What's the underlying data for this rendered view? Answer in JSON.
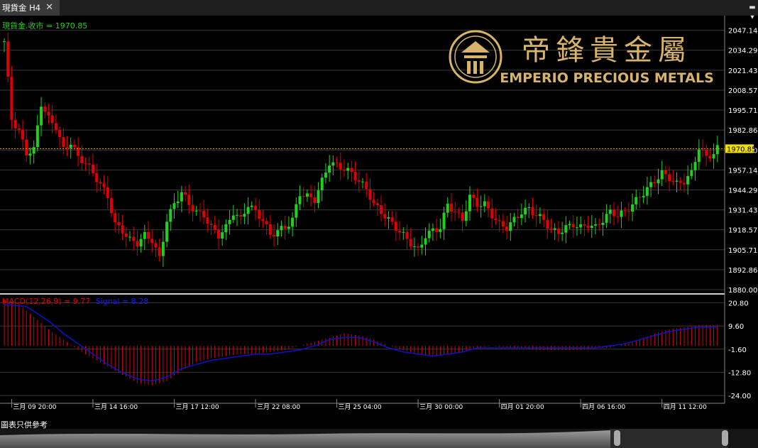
{
  "tab": {
    "title": "現貨金 H4",
    "close": "✕"
  },
  "logo": {
    "cn": "帝鋒貴金屬",
    "en": "EMPERIO PRECIOUS METALS"
  },
  "footer_note": "圖表只供參考",
  "colors": {
    "up": "#1fd11f",
    "down": "#e00000",
    "macd": "#e00000",
    "signal": "#1010cc",
    "grid": "#3a3a3a",
    "gold": "#d7b46a",
    "price_line": "#e8a000"
  },
  "chart_data": [
    {
      "type": "candlestick",
      "legend": "現貨金.收市 = 1970.85",
      "last_price": 1970.85,
      "price_tag": "1970.85",
      "ylim": [
        1880.0,
        2052.0
      ],
      "yticks": [
        "2047.14",
        "2034.29",
        "2021.43",
        "2008.57",
        "1995.71",
        "1982.86",
        "1970.00",
        "1957.14",
        "1944.29",
        "1931.43",
        "1918.57",
        "1905.71",
        "1892.86",
        "1880.00"
      ],
      "xticks": [
        "三月 09 20:00",
        "三月 14 16:00",
        "三月 17 12:00",
        "三月 22 08:00",
        "三月 25 04:00",
        "三月 30 00:00",
        "四月 01 20:00",
        "四月 06 16:00",
        "四月 11 12:00"
      ],
      "xtick_index": [
        2,
        24,
        46,
        68,
        90,
        112,
        134,
        156,
        178
      ],
      "bar_count": 194,
      "anchors": [
        [
          0,
          2040
        ],
        [
          2,
          1990
        ],
        [
          4,
          1982
        ],
        [
          6,
          1968
        ],
        [
          8,
          1970
        ],
        [
          10,
          2000
        ],
        [
          12,
          1990
        ],
        [
          14,
          1985
        ],
        [
          16,
          1970
        ],
        [
          18,
          1975
        ],
        [
          20,
          1965
        ],
        [
          22,
          1962
        ],
        [
          24,
          1955
        ],
        [
          26,
          1948
        ],
        [
          28,
          1940
        ],
        [
          30,
          1922
        ],
        [
          32,
          1918
        ],
        [
          34,
          1912
        ],
        [
          36,
          1910
        ],
        [
          38,
          1915
        ],
        [
          40,
          1912
        ],
        [
          42,
          1900
        ],
        [
          44,
          1925
        ],
        [
          46,
          1935
        ],
        [
          48,
          1943
        ],
        [
          50,
          1935
        ],
        [
          52,
          1930
        ],
        [
          54,
          1928
        ],
        [
          56,
          1920
        ],
        [
          58,
          1915
        ],
        [
          60,
          1920
        ],
        [
          62,
          1930
        ],
        [
          64,
          1925
        ],
        [
          66,
          1935
        ],
        [
          68,
          1930
        ],
        [
          70,
          1925
        ],
        [
          72,
          1915
        ],
        [
          74,
          1918
        ],
        [
          76,
          1920
        ],
        [
          78,
          1925
        ],
        [
          80,
          1942
        ],
        [
          82,
          1940
        ],
        [
          84,
          1938
        ],
        [
          86,
          1950
        ],
        [
          88,
          1962
        ],
        [
          90,
          1960
        ],
        [
          92,
          1958
        ],
        [
          94,
          1955
        ],
        [
          96,
          1950
        ],
        [
          98,
          1945
        ],
        [
          100,
          1935
        ],
        [
          102,
          1930
        ],
        [
          104,
          1925
        ],
        [
          106,
          1920
        ],
        [
          108,
          1915
        ],
        [
          110,
          1910
        ],
        [
          112,
          1905
        ],
        [
          114,
          1915
        ],
        [
          116,
          1918
        ],
        [
          118,
          1920
        ],
        [
          120,
          1935
        ],
        [
          122,
          1930
        ],
        [
          124,
          1925
        ],
        [
          126,
          1940
        ],
        [
          128,
          1935
        ],
        [
          130,
          1935
        ],
        [
          132,
          1928
        ],
        [
          134,
          1922
        ],
        [
          136,
          1920
        ],
        [
          138,
          1925
        ],
        [
          140,
          1930
        ],
        [
          142,
          1932
        ],
        [
          144,
          1928
        ],
        [
          146,
          1925
        ],
        [
          148,
          1918
        ],
        [
          150,
          1917
        ],
        [
          152,
          1920
        ],
        [
          154,
          1922
        ],
        [
          156,
          1920
        ],
        [
          158,
          1922
        ],
        [
          160,
          1920
        ],
        [
          162,
          1925
        ],
        [
          164,
          1930
        ],
        [
          166,
          1928
        ],
        [
          168,
          1930
        ],
        [
          170,
          1935
        ],
        [
          172,
          1940
        ],
        [
          174,
          1945
        ],
        [
          176,
          1950
        ],
        [
          178,
          1955
        ],
        [
          180,
          1952
        ],
        [
          182,
          1948
        ],
        [
          184,
          1950
        ],
        [
          186,
          1955
        ],
        [
          188,
          1972
        ],
        [
          190,
          1965
        ],
        [
          192,
          1968
        ],
        [
          193,
          1971
        ]
      ]
    },
    {
      "type": "macd",
      "legend_macd": "MACD(12,26,9) = 9.77",
      "legend_signal": "Signal = 8.28",
      "macd_value": 9.77,
      "signal_value": 8.28,
      "ylim": [
        -25.0,
        23.0
      ],
      "yticks": [
        "20.80",
        "9.60",
        "-1.60",
        "-12.80",
        "-24.00"
      ],
      "macd_anchors": [
        [
          0,
          22
        ],
        [
          4,
          20
        ],
        [
          8,
          14
        ],
        [
          12,
          8
        ],
        [
          16,
          3
        ],
        [
          20,
          -2
        ],
        [
          24,
          -6
        ],
        [
          28,
          -10
        ],
        [
          32,
          -14
        ],
        [
          36,
          -18
        ],
        [
          40,
          -19
        ],
        [
          44,
          -17
        ],
        [
          48,
          -12
        ],
        [
          52,
          -8
        ],
        [
          56,
          -6
        ],
        [
          60,
          -5
        ],
        [
          64,
          -4
        ],
        [
          68,
          -4
        ],
        [
          72,
          -3
        ],
        [
          76,
          -2
        ],
        [
          80,
          0
        ],
        [
          84,
          2
        ],
        [
          88,
          4
        ],
        [
          92,
          6
        ],
        [
          96,
          5
        ],
        [
          100,
          3
        ],
        [
          104,
          0
        ],
        [
          108,
          -2
        ],
        [
          112,
          -4
        ],
        [
          116,
          -5
        ],
        [
          120,
          -4
        ],
        [
          124,
          -3
        ],
        [
          128,
          -1
        ],
        [
          132,
          0
        ],
        [
          136,
          -1
        ],
        [
          140,
          -1
        ],
        [
          144,
          -2
        ],
        [
          148,
          -2
        ],
        [
          152,
          -2
        ],
        [
          156,
          -2
        ],
        [
          160,
          -1
        ],
        [
          164,
          -1
        ],
        [
          168,
          1
        ],
        [
          172,
          3
        ],
        [
          176,
          6
        ],
        [
          180,
          8
        ],
        [
          184,
          9
        ],
        [
          188,
          10
        ],
        [
          193,
          10
        ]
      ],
      "signal_anchors": [
        [
          0,
          20
        ],
        [
          6,
          19
        ],
        [
          12,
          12
        ],
        [
          16,
          6
        ],
        [
          20,
          1
        ],
        [
          24,
          -4
        ],
        [
          28,
          -9
        ],
        [
          32,
          -13
        ],
        [
          36,
          -16
        ],
        [
          40,
          -17
        ],
        [
          44,
          -15
        ],
        [
          48,
          -11
        ],
        [
          52,
          -9
        ],
        [
          56,
          -7
        ],
        [
          60,
          -6
        ],
        [
          64,
          -5
        ],
        [
          68,
          -4
        ],
        [
          72,
          -4
        ],
        [
          76,
          -3
        ],
        [
          80,
          -2
        ],
        [
          84,
          0
        ],
        [
          88,
          3
        ],
        [
          92,
          4
        ],
        [
          96,
          4
        ],
        [
          100,
          2
        ],
        [
          104,
          -1
        ],
        [
          108,
          -3
        ],
        [
          112,
          -4
        ],
        [
          116,
          -5
        ],
        [
          120,
          -4
        ],
        [
          124,
          -3
        ],
        [
          128,
          -1
        ],
        [
          132,
          -1
        ],
        [
          136,
          -1
        ],
        [
          140,
          -1
        ],
        [
          144,
          -1
        ],
        [
          148,
          -1
        ],
        [
          152,
          -1
        ],
        [
          156,
          -1
        ],
        [
          160,
          -1
        ],
        [
          164,
          0
        ],
        [
          168,
          1
        ],
        [
          172,
          3
        ],
        [
          176,
          5
        ],
        [
          180,
          7
        ],
        [
          184,
          8
        ],
        [
          188,
          9
        ],
        [
          193,
          9
        ]
      ]
    }
  ]
}
